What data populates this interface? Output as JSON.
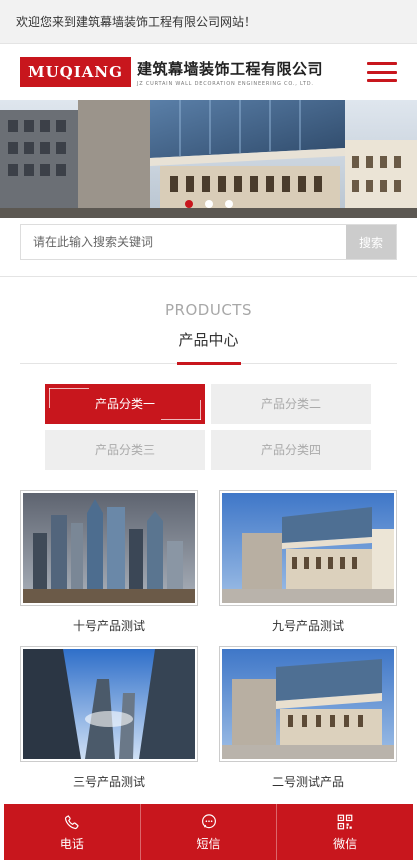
{
  "topbar": {
    "welcome": "欢迎您来到建筑幕墙装饰工程有限公司网站！"
  },
  "header": {
    "logo_mark": "MUQIANG",
    "logo_cn": "建筑幕墙装饰工程有限公司",
    "logo_en": "JZ CURTAIN WALL DECORATION ENGINEERING CO., LTD.",
    "menu_icon": "hamburger-menu-icon",
    "accent_color": "#c8161d"
  },
  "banner": {
    "slides": 3,
    "active_slide": 1
  },
  "search": {
    "placeholder": "请在此输入搜索关键词",
    "button_label": "搜索"
  },
  "products_section": {
    "title_en": "PRODUCTS",
    "title_cn": "产品中心",
    "categories": [
      {
        "label": "产品分类一",
        "active": true
      },
      {
        "label": "产品分类二",
        "active": false
      },
      {
        "label": "产品分类三",
        "active": false
      },
      {
        "label": "产品分类四",
        "active": false
      }
    ],
    "items": [
      {
        "title": "十号产品测试"
      },
      {
        "title": "九号产品测试"
      },
      {
        "title": "三号产品测试"
      },
      {
        "title": "二号测试产品"
      }
    ]
  },
  "footer": {
    "buttons": [
      {
        "label": "电话",
        "icon": "phone-icon"
      },
      {
        "label": "短信",
        "icon": "message-icon"
      },
      {
        "label": "微信",
        "icon": "qr-code-icon"
      }
    ]
  }
}
